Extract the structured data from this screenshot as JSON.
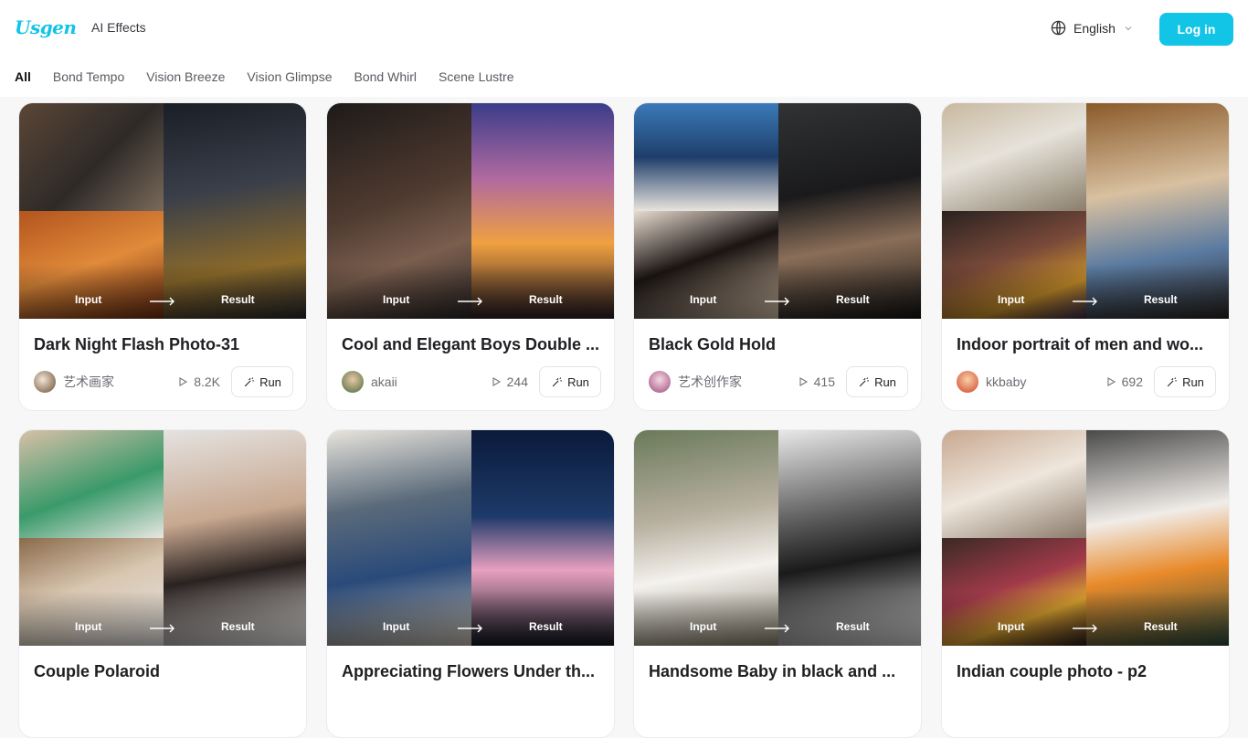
{
  "header": {
    "logo": "Usgen",
    "nav_ai_effects": "AI Effects",
    "language": "English",
    "login_label": "Log in",
    "accent_color": "#12c4e6"
  },
  "tabs": [
    {
      "label": "All",
      "active": true
    },
    {
      "label": "Bond Tempo",
      "active": false
    },
    {
      "label": "Vision Breeze",
      "active": false
    },
    {
      "label": "Vision Glimpse",
      "active": false
    },
    {
      "label": "Bond Whirl",
      "active": false
    },
    {
      "label": "Scene Lustre",
      "active": false
    }
  ],
  "common": {
    "input_label": "Input",
    "result_label": "Result",
    "run_label": "Run"
  },
  "cards": [
    {
      "title": "Dark Night Flash Photo-31",
      "author": "艺术画家",
      "runs": "8.2K"
    },
    {
      "title": "Cool and Elegant Boys Double ...",
      "author": "akaii",
      "runs": "244"
    },
    {
      "title": "Black Gold Hold",
      "author": "艺术创作家",
      "runs": "415"
    },
    {
      "title": "Indoor portrait of men and wo...",
      "author": "kkbaby",
      "runs": "692"
    },
    {
      "title": "Couple Polaroid",
      "author": "",
      "runs": ""
    },
    {
      "title": "Appreciating Flowers Under th...",
      "author": "",
      "runs": ""
    },
    {
      "title": "Handsome Baby in black and ...",
      "author": "",
      "runs": ""
    },
    {
      "title": "Indian couple photo - p2",
      "author": "",
      "runs": ""
    }
  ]
}
